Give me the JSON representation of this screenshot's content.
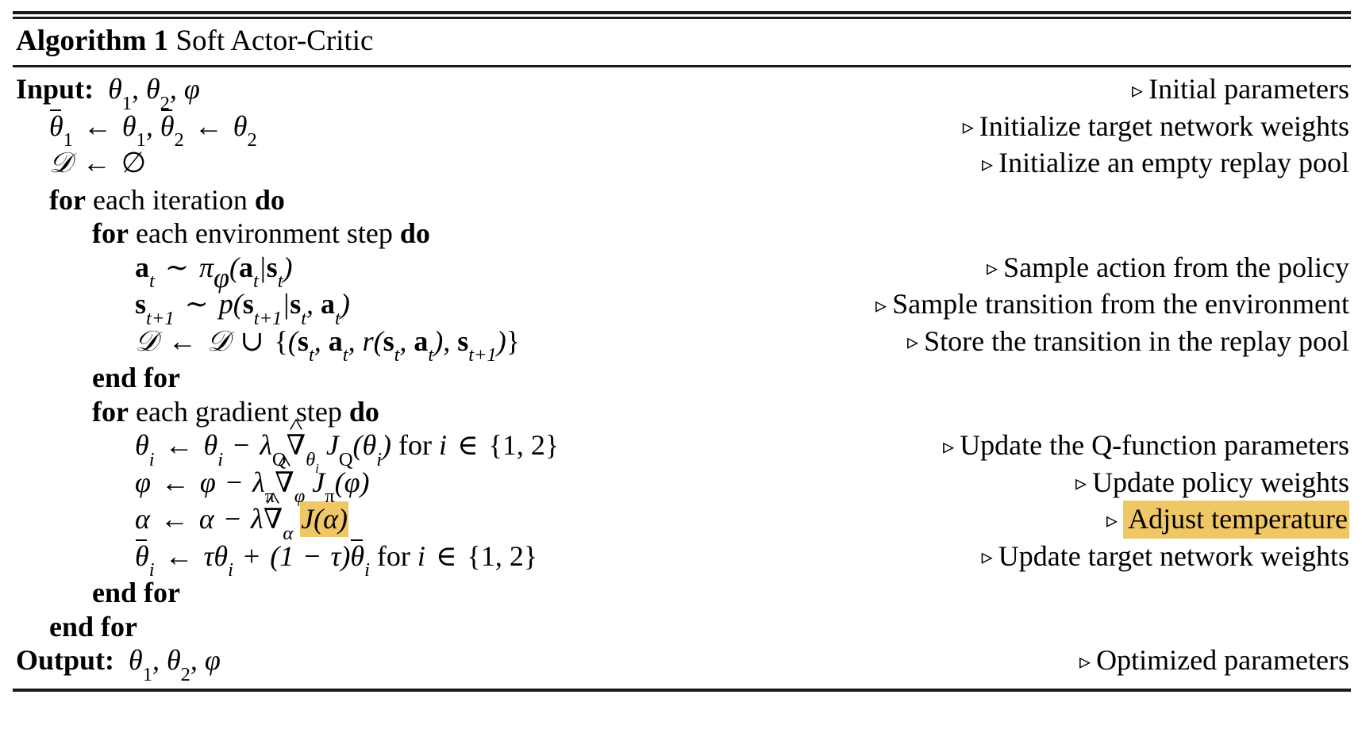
{
  "algorithm": {
    "number_label": "Algorithm 1",
    "name": "Soft Actor-Critic",
    "highlight_color": "#efc767",
    "comment_marker": "▹",
    "lines": [
      {
        "id": "input",
        "indent": 0,
        "keyword": "Input:",
        "code_text": "θ1, θ2, ϕ",
        "comment": "Initial parameters",
        "highlighted": false
      },
      {
        "id": "init-targets",
        "indent": 1,
        "code_text": "θ̄1 ← θ1, θ̄2 ← θ2",
        "comment": "Initialize target network weights",
        "highlighted": false
      },
      {
        "id": "init-buffer",
        "indent": 1,
        "code_text": "𝒟 ← ∅",
        "comment": "Initialize an empty replay pool",
        "highlighted": false
      },
      {
        "id": "for-iteration",
        "indent": 1,
        "code_text": "for each iteration do",
        "comment": "",
        "highlighted": false
      },
      {
        "id": "for-env-step",
        "indent": 2,
        "code_text": "for each environment step do",
        "comment": "",
        "highlighted": false
      },
      {
        "id": "sample-action",
        "indent": 3,
        "code_text": "a_t ~ π_ϕ(a_t|s_t)",
        "comment": "Sample action from the policy",
        "highlighted": false
      },
      {
        "id": "sample-transition",
        "indent": 3,
        "code_text": "s_{t+1} ~ p(s_{t+1}|s_t, a_t)",
        "comment": "Sample transition from the environment",
        "highlighted": false
      },
      {
        "id": "store-transition",
        "indent": 3,
        "code_text": "𝒟 ← 𝒟 ∪ {(s_t, a_t, r(s_t, a_t), s_{t+1})}",
        "comment": "Store the transition in the replay pool",
        "highlighted": false
      },
      {
        "id": "end-for-env",
        "indent": 2,
        "code_text": "end for",
        "comment": "",
        "highlighted": false
      },
      {
        "id": "for-gradient-step",
        "indent": 2,
        "code_text": "for each gradient step do",
        "comment": "",
        "highlighted": false
      },
      {
        "id": "update-q",
        "indent": 3,
        "code_text": "θ_i ← θ_i − λ_Q ∇̂_{θ_i} J_Q(θ_i) for i ∈ {1, 2}",
        "comment": "Update the Q-function parameters",
        "highlighted": false
      },
      {
        "id": "update-policy",
        "indent": 3,
        "code_text": "ϕ ← ϕ − λ_π ∇̂_ϕ J_π(ϕ)",
        "comment": "Update policy weights",
        "highlighted": false
      },
      {
        "id": "update-temperature",
        "indent": 3,
        "code_text": "α ← α − λ ∇̂_α J(α)",
        "comment": "Adjust temperature",
        "highlighted": true
      },
      {
        "id": "update-targets",
        "indent": 3,
        "code_text": "θ̄_i ← τθ_i + (1 − τ)θ̄_i for i ∈ {1, 2}",
        "comment": "Update target network weights",
        "highlighted": false
      },
      {
        "id": "end-for-gradient",
        "indent": 2,
        "code_text": "end for",
        "comment": "",
        "highlighted": false
      },
      {
        "id": "end-for-iteration",
        "indent": 1,
        "code_text": "end for",
        "comment": "",
        "highlighted": false
      },
      {
        "id": "output",
        "indent": 0,
        "keyword": "Output:",
        "code_text": "θ1, θ2, ϕ",
        "comment": "Optimized parameters",
        "highlighted": false
      }
    ],
    "comments": {
      "initial_parameters": "Initial parameters",
      "initialize_target_network_weights": "Initialize target network weights",
      "initialize_empty_replay_pool": "Initialize an empty replay pool",
      "sample_action": "Sample action from the policy",
      "sample_transition": "Sample transition from the environment",
      "store_transition": "Store the transition in the replay pool",
      "update_q_params": "Update the Q-function parameters",
      "update_policy_weights": "Update policy weights",
      "adjust_temperature": "Adjust temperature",
      "update_target_weights": "Update target network weights",
      "optimized_parameters": "Optimized parameters"
    },
    "keywords": {
      "input": "Input:",
      "output": "Output:",
      "for": "for",
      "do": "do",
      "end_for": "end for",
      "each_iteration": "each iteration",
      "each_environment_step": "each environment step",
      "each_gradient_step": "each gradient step"
    }
  }
}
